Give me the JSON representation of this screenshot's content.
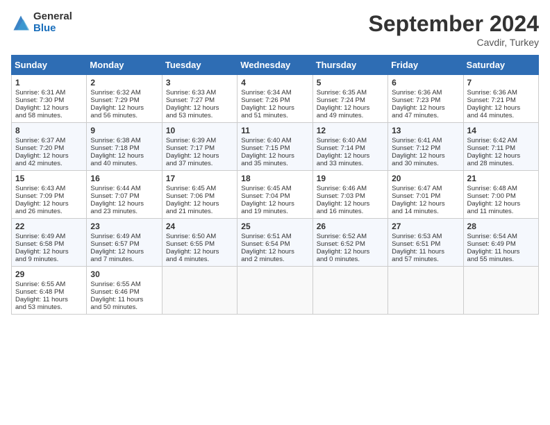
{
  "header": {
    "logo_general": "General",
    "logo_blue": "Blue",
    "title": "September 2024",
    "location": "Cavdir, Turkey"
  },
  "weekdays": [
    "Sunday",
    "Monday",
    "Tuesday",
    "Wednesday",
    "Thursday",
    "Friday",
    "Saturday"
  ],
  "weeks": [
    [
      {
        "day": "1",
        "lines": [
          "Sunrise: 6:31 AM",
          "Sunset: 7:30 PM",
          "Daylight: 12 hours",
          "and 58 minutes."
        ]
      },
      {
        "day": "2",
        "lines": [
          "Sunrise: 6:32 AM",
          "Sunset: 7:29 PM",
          "Daylight: 12 hours",
          "and 56 minutes."
        ]
      },
      {
        "day": "3",
        "lines": [
          "Sunrise: 6:33 AM",
          "Sunset: 7:27 PM",
          "Daylight: 12 hours",
          "and 53 minutes."
        ]
      },
      {
        "day": "4",
        "lines": [
          "Sunrise: 6:34 AM",
          "Sunset: 7:26 PM",
          "Daylight: 12 hours",
          "and 51 minutes."
        ]
      },
      {
        "day": "5",
        "lines": [
          "Sunrise: 6:35 AM",
          "Sunset: 7:24 PM",
          "Daylight: 12 hours",
          "and 49 minutes."
        ]
      },
      {
        "day": "6",
        "lines": [
          "Sunrise: 6:36 AM",
          "Sunset: 7:23 PM",
          "Daylight: 12 hours",
          "and 47 minutes."
        ]
      },
      {
        "day": "7",
        "lines": [
          "Sunrise: 6:36 AM",
          "Sunset: 7:21 PM",
          "Daylight: 12 hours",
          "and 44 minutes."
        ]
      }
    ],
    [
      {
        "day": "8",
        "lines": [
          "Sunrise: 6:37 AM",
          "Sunset: 7:20 PM",
          "Daylight: 12 hours",
          "and 42 minutes."
        ]
      },
      {
        "day": "9",
        "lines": [
          "Sunrise: 6:38 AM",
          "Sunset: 7:18 PM",
          "Daylight: 12 hours",
          "and 40 minutes."
        ]
      },
      {
        "day": "10",
        "lines": [
          "Sunrise: 6:39 AM",
          "Sunset: 7:17 PM",
          "Daylight: 12 hours",
          "and 37 minutes."
        ]
      },
      {
        "day": "11",
        "lines": [
          "Sunrise: 6:40 AM",
          "Sunset: 7:15 PM",
          "Daylight: 12 hours",
          "and 35 minutes."
        ]
      },
      {
        "day": "12",
        "lines": [
          "Sunrise: 6:40 AM",
          "Sunset: 7:14 PM",
          "Daylight: 12 hours",
          "and 33 minutes."
        ]
      },
      {
        "day": "13",
        "lines": [
          "Sunrise: 6:41 AM",
          "Sunset: 7:12 PM",
          "Daylight: 12 hours",
          "and 30 minutes."
        ]
      },
      {
        "day": "14",
        "lines": [
          "Sunrise: 6:42 AM",
          "Sunset: 7:11 PM",
          "Daylight: 12 hours",
          "and 28 minutes."
        ]
      }
    ],
    [
      {
        "day": "15",
        "lines": [
          "Sunrise: 6:43 AM",
          "Sunset: 7:09 PM",
          "Daylight: 12 hours",
          "and 26 minutes."
        ]
      },
      {
        "day": "16",
        "lines": [
          "Sunrise: 6:44 AM",
          "Sunset: 7:07 PM",
          "Daylight: 12 hours",
          "and 23 minutes."
        ]
      },
      {
        "day": "17",
        "lines": [
          "Sunrise: 6:45 AM",
          "Sunset: 7:06 PM",
          "Daylight: 12 hours",
          "and 21 minutes."
        ]
      },
      {
        "day": "18",
        "lines": [
          "Sunrise: 6:45 AM",
          "Sunset: 7:04 PM",
          "Daylight: 12 hours",
          "and 19 minutes."
        ]
      },
      {
        "day": "19",
        "lines": [
          "Sunrise: 6:46 AM",
          "Sunset: 7:03 PM",
          "Daylight: 12 hours",
          "and 16 minutes."
        ]
      },
      {
        "day": "20",
        "lines": [
          "Sunrise: 6:47 AM",
          "Sunset: 7:01 PM",
          "Daylight: 12 hours",
          "and 14 minutes."
        ]
      },
      {
        "day": "21",
        "lines": [
          "Sunrise: 6:48 AM",
          "Sunset: 7:00 PM",
          "Daylight: 12 hours",
          "and 11 minutes."
        ]
      }
    ],
    [
      {
        "day": "22",
        "lines": [
          "Sunrise: 6:49 AM",
          "Sunset: 6:58 PM",
          "Daylight: 12 hours",
          "and 9 minutes."
        ]
      },
      {
        "day": "23",
        "lines": [
          "Sunrise: 6:49 AM",
          "Sunset: 6:57 PM",
          "Daylight: 12 hours",
          "and 7 minutes."
        ]
      },
      {
        "day": "24",
        "lines": [
          "Sunrise: 6:50 AM",
          "Sunset: 6:55 PM",
          "Daylight: 12 hours",
          "and 4 minutes."
        ]
      },
      {
        "day": "25",
        "lines": [
          "Sunrise: 6:51 AM",
          "Sunset: 6:54 PM",
          "Daylight: 12 hours",
          "and 2 minutes."
        ]
      },
      {
        "day": "26",
        "lines": [
          "Sunrise: 6:52 AM",
          "Sunset: 6:52 PM",
          "Daylight: 12 hours",
          "and 0 minutes."
        ]
      },
      {
        "day": "27",
        "lines": [
          "Sunrise: 6:53 AM",
          "Sunset: 6:51 PM",
          "Daylight: 11 hours",
          "and 57 minutes."
        ]
      },
      {
        "day": "28",
        "lines": [
          "Sunrise: 6:54 AM",
          "Sunset: 6:49 PM",
          "Daylight: 11 hours",
          "and 55 minutes."
        ]
      }
    ],
    [
      {
        "day": "29",
        "lines": [
          "Sunrise: 6:55 AM",
          "Sunset: 6:48 PM",
          "Daylight: 11 hours",
          "and 53 minutes."
        ]
      },
      {
        "day": "30",
        "lines": [
          "Sunrise: 6:55 AM",
          "Sunset: 6:46 PM",
          "Daylight: 11 hours",
          "and 50 minutes."
        ]
      },
      {
        "day": "",
        "lines": []
      },
      {
        "day": "",
        "lines": []
      },
      {
        "day": "",
        "lines": []
      },
      {
        "day": "",
        "lines": []
      },
      {
        "day": "",
        "lines": []
      }
    ]
  ]
}
